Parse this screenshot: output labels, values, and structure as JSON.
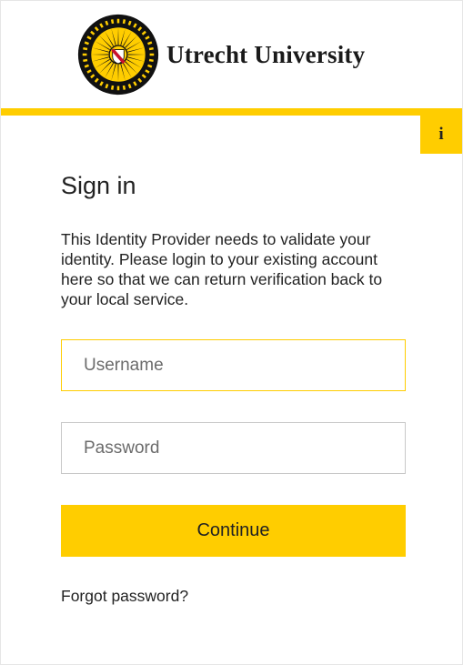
{
  "header": {
    "logo_icon": "university-seal-icon",
    "university_name": "Utrecht University",
    "brand_color": "#ffcd00",
    "info_button": {
      "glyph": "i",
      "icon": "info-icon"
    }
  },
  "main": {
    "title": "Sign in",
    "description": "This Identity Provider needs to validate your identity. Please login to your existing account here so that we can return verification back to your local service.",
    "username": {
      "placeholder": "Username",
      "value": ""
    },
    "password": {
      "placeholder": "Password",
      "value": ""
    },
    "continue_label": "Continue",
    "forgot_label": "Forgot password?"
  }
}
